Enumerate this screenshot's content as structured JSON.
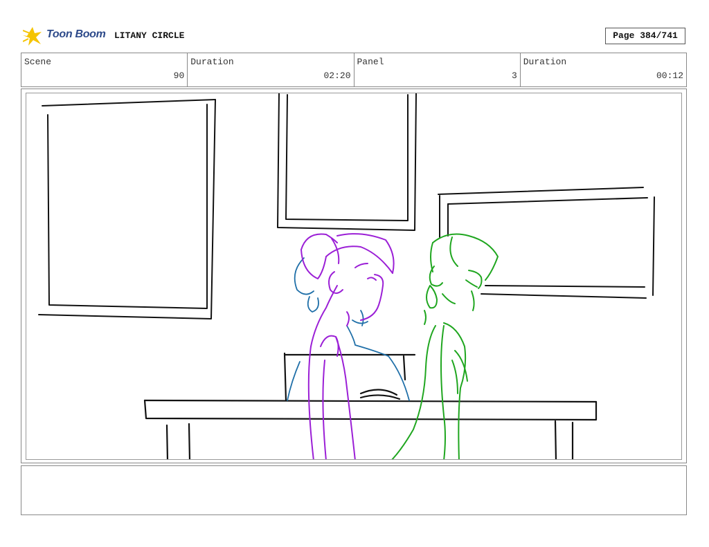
{
  "header": {
    "logo_text": "Toon Boom",
    "project_title": "LITANY CIRCLE",
    "page_label": "Page 384/741"
  },
  "info": {
    "scene_label": "Scene",
    "scene_value": "90",
    "scene_duration_label": "Duration",
    "scene_duration_value": "02:20",
    "panel_label": "Panel",
    "panel_value": "3",
    "panel_duration_label": "Duration",
    "panel_duration_value": "00:12"
  },
  "notes": {
    "text": ""
  },
  "colors": {
    "logo_star": "#f5c400",
    "logo_text": "#2d4a8a",
    "sketch_lines": "#111111",
    "character_purple": "#9b1fd6",
    "character_blue": "#1f6fa8",
    "character_green": "#1fa61f"
  }
}
